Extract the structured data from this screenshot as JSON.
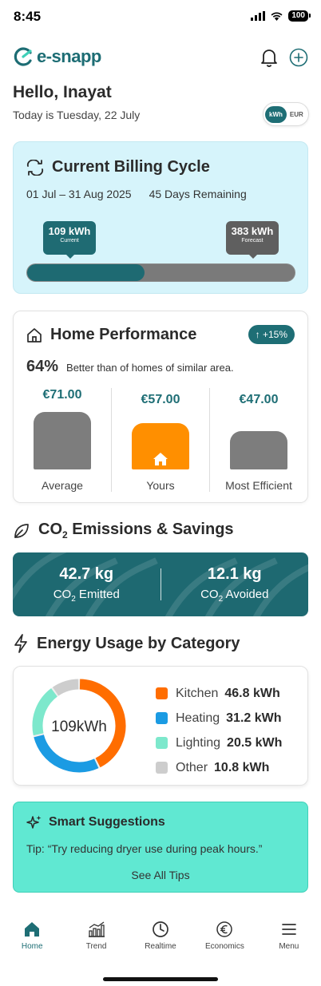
{
  "status_bar": {
    "time": "8:45",
    "battery": "100"
  },
  "app": {
    "brand": "e-snapp"
  },
  "greeting": {
    "hello": "Hello, Inayat",
    "date": "Today is Tuesday, 22 July"
  },
  "unit_toggle": {
    "selected": "kWh",
    "other": "EUR"
  },
  "billing": {
    "title": "Current Billing Cycle",
    "period": "01 Jul – 31 Aug 2025",
    "remaining": "45 Days Remaining",
    "current_value": "109 kWh",
    "current_label": "Current",
    "forecast_value": "383 kWh",
    "forecast_label": "Forecast",
    "progress_fraction": 0.44
  },
  "home_performance": {
    "title": "Home Performance",
    "badge": "↑ +15%",
    "percent": "64%",
    "comparison_text": "Better than of homes of similar area.",
    "columns": [
      {
        "price": "€71.00",
        "label": "Average",
        "value": 71.0,
        "color": "#7d7d7d"
      },
      {
        "price": "€57.00",
        "label": "Yours",
        "value": 57.0,
        "color": "#ff8f00"
      },
      {
        "price": "€47.00",
        "label": "Most Efficient",
        "value": 47.0,
        "color": "#7d7d7d"
      }
    ]
  },
  "co2": {
    "title_prefix": "CO",
    "title_sub": "2",
    "title_suffix": " Emissions & Savings",
    "emitted_value": "42.7 kg",
    "emitted_label_prefix": "CO",
    "emitted_label_sub": "2",
    "emitted_label_suffix": " Emitted",
    "avoided_value": "12.1 kg",
    "avoided_label_prefix": "CO",
    "avoided_label_sub": "2",
    "avoided_label_suffix": " Avoided"
  },
  "energy_usage": {
    "title": "Energy Usage by Category",
    "total": "109kWh",
    "categories": [
      {
        "name": "Kitchen",
        "value_text": "46.8 kWh",
        "value": 46.8,
        "color": "#ff6d00"
      },
      {
        "name": "Heating",
        "value_text": "31.2 kWh",
        "value": 31.2,
        "color": "#1b9be3"
      },
      {
        "name": "Lighting",
        "value_text": "20.5 kWh",
        "value": 20.5,
        "color": "#7de8cc"
      },
      {
        "name": "Other",
        "value_text": "10.8 kWh",
        "value": 10.8,
        "color": "#cdcdcd"
      }
    ]
  },
  "suggestions": {
    "title": "Smart Suggestions",
    "tip": "Tip: “Try reducing dryer use during peak hours.”",
    "see_all": "See All Tips"
  },
  "tabs": [
    {
      "label": "Home",
      "icon": "home-icon",
      "active": true
    },
    {
      "label": "Trend",
      "icon": "trend-chart-icon",
      "active": false
    },
    {
      "label": "Realtime",
      "icon": "clock-icon",
      "active": false
    },
    {
      "label": "Economics",
      "icon": "euro-icon",
      "active": false
    },
    {
      "label": "Menu",
      "icon": "menu-icon",
      "active": false
    }
  ]
}
